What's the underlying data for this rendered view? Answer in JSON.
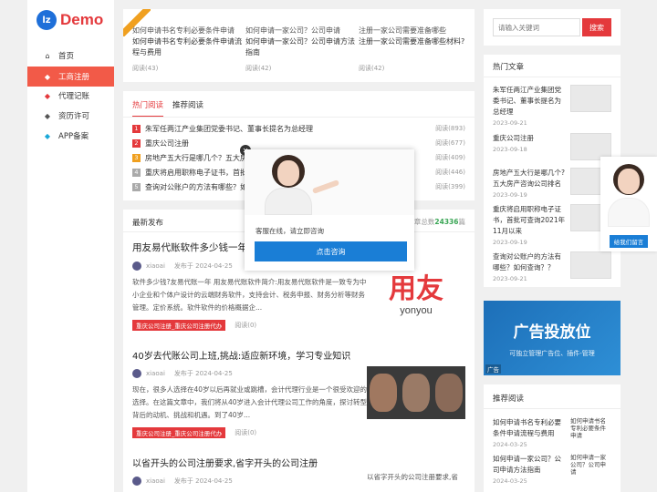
{
  "logo": {
    "badge": "lz",
    "text": "Demo"
  },
  "nav": [
    {
      "label": "首页",
      "icon": "home-icon",
      "glyph": "⌂"
    },
    {
      "label": "工商注册",
      "icon": "tag-icon",
      "glyph": "◆",
      "active": true
    },
    {
      "label": "代理记账",
      "icon": "tag-icon",
      "glyph": "◆"
    },
    {
      "label": "资历许可",
      "icon": "tag-icon",
      "glyph": "◆"
    },
    {
      "label": "APP备案",
      "icon": "tags-icon",
      "glyph": "◆"
    }
  ],
  "cards": [
    {
      "cover": "如何申请书名专利必要条件申请",
      "title": "如何申请书名专利必要条件申请流程与费用",
      "reads": "阅读(43)"
    },
    {
      "cover": "如何申请一家公司？公司申请",
      "title": "如何申请一家公司？公司申请方法指南",
      "reads": "阅读(42)"
    },
    {
      "cover": "注册一家公司需要准备哪些",
      "title": "注册一家公司需要准备哪些材料?",
      "reads": "阅读(42)"
    }
  ],
  "hot": {
    "tabs": [
      "热门阅读",
      "推荐阅读"
    ],
    "items": [
      {
        "n": "1",
        "title": "朱军任两江产业集团党委书记、董事长提名为总经理",
        "reads": "阅读(893)",
        "color": "#e4393c"
      },
      {
        "n": "2",
        "title": "重庆公司注册",
        "reads": "阅读(677)",
        "color": "#e4393c"
      },
      {
        "n": "3",
        "title": "房地产五大行是哪几个？五大房",
        "reads": "阅读(409)",
        "color": "#f0a020"
      },
      {
        "n": "4",
        "title": "重庆将启用职称电子证书，首批",
        "reads": "阅读(446)",
        "color": "#999999"
      },
      {
        "n": "5",
        "title": "查询对公账户的方法有哪些？如",
        "reads": "阅读(399)",
        "color": "#999999"
      }
    ]
  },
  "latest": {
    "title": "最新发布",
    "total_label": "文章总数",
    "total": "24336",
    "total_unit": "篇",
    "articles": [
      {
        "title": "用友易代账软件多少钱一年",
        "author": "xiaoai",
        "date": "发布于 2024-04-25",
        "excerpt": "软件多少钱?友易代账一年 用友易代账软件简介:用友易代账软件是一致专为中小企业和个体户设计的云端财务软件，支持会计、税务申报、财务分析等财务管理。定价系统。软件软件的价格概据企...",
        "tag": "重庆公司注册_重庆公司注册代办",
        "reads": "阅读(0)",
        "image": "yonyou"
      },
      {
        "title": "40岁去代账公司上班,挑战:适应新环境，学习专业知识",
        "author": "xiaoai",
        "date": "发布于 2024-04-25",
        "excerpt": "现在，很多人选择在40岁以后再就业或跳槽，会计代理行业是一个很受欢迎的选择。在这篇文章中，我们将从40岁进入会计代理公司工作的角度，探讨转型背后的动机、挑战和机遇。到了40岁...",
        "tag": "重庆公司注册_重庆公司注册代办",
        "reads": "阅读(0)",
        "image": "faces"
      },
      {
        "title": "以省开头的公司注册要求,省字开头的公司注册",
        "author": "xiaoai",
        "date": "发布于 2024-04-25",
        "excerpt": "",
        "tag": "",
        "reads": "",
        "image": "placeholder",
        "cover": "以省字开头的公司注册要求,省"
      }
    ]
  },
  "yonyou": {
    "cn": "用友",
    "en": "yonyou"
  },
  "search": {
    "placeholder": "请输入关键词",
    "button": "搜索"
  },
  "popular": {
    "title": "热门文章",
    "items": [
      {
        "title": "朱军任两江产业集团党委书记、董事长提名为总经理",
        "date": "2023-09-21"
      },
      {
        "title": "重庆公司注册",
        "date": "2023-09-18"
      },
      {
        "title": "房地产五大行是哪几个?五大房产咨询公司排名",
        "date": "2023-09-19"
      },
      {
        "title": "重庆将启用职称电子证书，首批可查询2021年11月以来",
        "date": "2023-09-19"
      },
      {
        "title": "查询对公账户的方法有哪些？如何查询？？",
        "date": "2023-09-21"
      }
    ]
  },
  "ad": {
    "title": "广告投放位",
    "sub": "可独立管理广告位、插件-管理",
    "corner": "广告"
  },
  "recommend": {
    "title": "推荐阅读",
    "items": [
      {
        "title": "如何申请书名专利必要条件申请流程与费用",
        "date": "2024-03-25",
        "cover": "如何申请书名专利必要条件申请"
      },
      {
        "title": "如何申请一家公司？公司申请方法指南",
        "date": "2024-03-25",
        "cover": "如何申请一家公司？公司申请"
      }
    ]
  },
  "chat": {
    "text": "客服在线，请立即咨询",
    "button": "点击咨询"
  },
  "float_service": {
    "button": "给我们留言"
  }
}
